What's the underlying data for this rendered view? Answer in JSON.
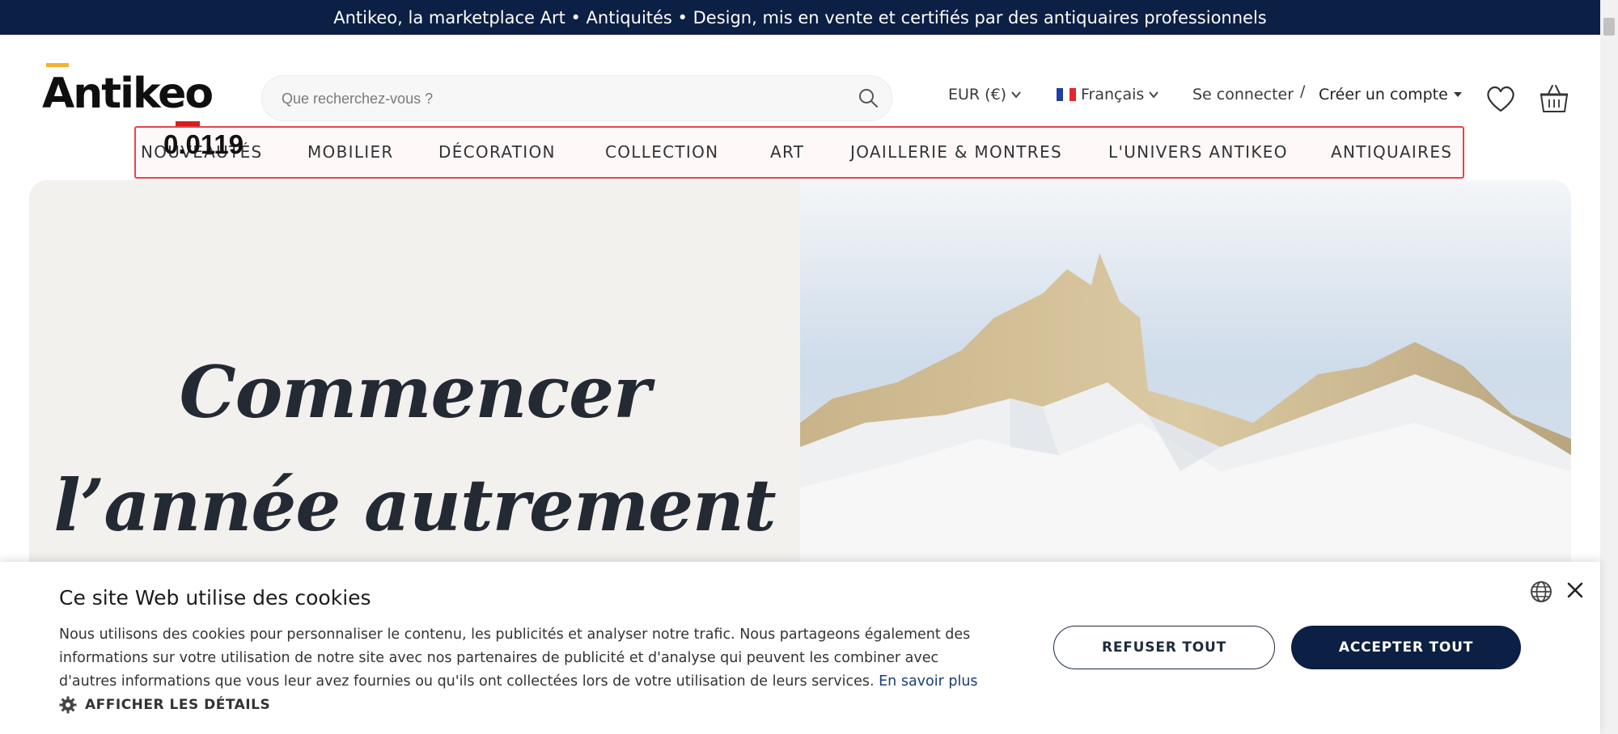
{
  "banner": {
    "text": "Antikeo, la marketplace Art • Antiquités • Design, mis en vente et certifiés par des antiquaires professionnels"
  },
  "header": {
    "logo_text": "Antikeo",
    "search_placeholder": "Que recherchez-vous ?",
    "currency": "EUR (€)",
    "language": "Français",
    "login": "Se connecter",
    "separator": "/",
    "create_account": "Créer un compte"
  },
  "nav": {
    "items": [
      "NOUVEAUTÉS",
      "MOBILIER",
      "DÉCORATION",
      "COLLECTION",
      "ART",
      "JOAILLERIE & MONTRES",
      "L'UNIVERS ANTIKEO",
      "ANTIQUAIRES"
    ],
    "overlay_label": "0.0119"
  },
  "hero": {
    "line1": "Commencer",
    "line2": "l’année autrement"
  },
  "cookie": {
    "title": "Ce site Web utilise des cookies",
    "text": "Nous utilisons des cookies pour personnaliser le contenu, les publicités et analyser notre trafic. Nous partageons également des informations sur votre utilisation de notre site avec nos partenaires de publicité et d'analyse qui peuvent les combiner avec d'autres informations que vous leur avez fournies ou qu'ils ont collectées lors de votre utilisation de leurs services.",
    "learn_more": "En savoir plus",
    "details": "AFFICHER LES DÉTAILS",
    "refuse": "REFUSER TOUT",
    "accept": "ACCEPTER TOUT"
  },
  "colors": {
    "navy": "#0c1f44",
    "logo_accent": "#f2b233",
    "highlight": "#e8434a"
  },
  "icons": [
    "search-icon",
    "chevron-down-icon",
    "france-flag-icon",
    "heart-icon",
    "basket-icon",
    "gear-icon",
    "globe-icon",
    "close-icon"
  ]
}
